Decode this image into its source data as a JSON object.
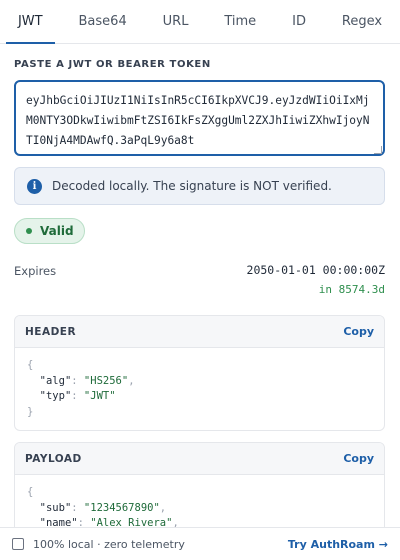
{
  "tabs": [
    {
      "label": "JWT",
      "active": true
    },
    {
      "label": "Base64",
      "active": false
    },
    {
      "label": "URL",
      "active": false
    },
    {
      "label": "Time",
      "active": false
    },
    {
      "label": "ID",
      "active": false
    },
    {
      "label": "Regex",
      "active": false
    }
  ],
  "input": {
    "label": "PASTE A JWT OR BEARER TOKEN",
    "value": "eyJhbGciOiJIUzI1NiIsInR5cCI6IkpXVCJ9.eyJzdWIiOiIxMjM0NTY3ODkwIiwibmFtZSI6IkFsZXggUml2ZXJhIiwiZXhwIjoyNTI0NjA4MDAwfQ.3aPqL9y6a8t"
  },
  "notice": {
    "icon": "info-icon",
    "text": "Decoded locally. The signature is NOT verified."
  },
  "status": {
    "label": "Valid",
    "color": "#2f8f4e"
  },
  "expires": {
    "label": "Expires",
    "value": "2050-01-01 00:00:00Z",
    "relative": "in 8574.3d"
  },
  "header_card": {
    "title": "HEADER",
    "copy_label": "Copy",
    "lines": [
      {
        "text": "{"
      },
      {
        "key": "\"alg\"",
        "value": "\"HS256\"",
        "trail": ","
      },
      {
        "key": "\"typ\"",
        "value": "\"JWT\"",
        "trail": ""
      },
      {
        "text": "}"
      }
    ]
  },
  "payload_card": {
    "title": "PAYLOAD",
    "copy_label": "Copy",
    "lines": [
      {
        "text": "{"
      },
      {
        "key": "\"sub\"",
        "value": "\"1234567890\"",
        "trail": ","
      },
      {
        "key": "\"name\"",
        "value": "\"Alex Rivera\"",
        "trail": ","
      }
    ]
  },
  "footer": {
    "checkbox_label": "100% local · zero telemetry",
    "link_label": "Try AuthRoam →"
  },
  "colors": {
    "accent": "#1e5fa8",
    "success": "#2f8f4e"
  }
}
